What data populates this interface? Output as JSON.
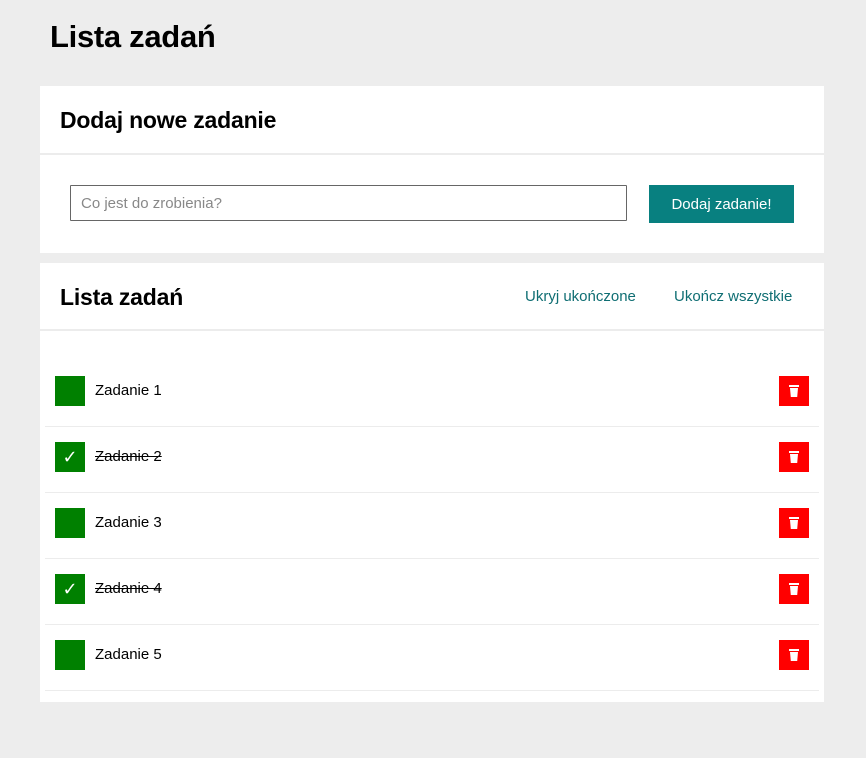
{
  "page": {
    "title": "Lista zadań"
  },
  "add_section": {
    "title": "Dodaj nowe zadanie",
    "input_placeholder": "Co jest do zrobienia?",
    "input_value": "",
    "button_label": "Dodaj zadanie!"
  },
  "list_section": {
    "title": "Lista zadań",
    "hide_completed_label": "Ukryj ukończone",
    "complete_all_label": "Ukończ wszystkie",
    "tasks": [
      {
        "label": "Zadanie 1",
        "done": false
      },
      {
        "label": "Zadanie 2",
        "done": true
      },
      {
        "label": "Zadanie 3",
        "done": false
      },
      {
        "label": "Zadanie 4",
        "done": true
      },
      {
        "label": "Zadanie 5",
        "done": false
      }
    ]
  },
  "icons": {
    "checkmark": "check-icon",
    "delete": "trash-icon"
  },
  "colors": {
    "background": "#ededed",
    "accent": "#088080",
    "link": "#0f6e73",
    "checkbox": "#008000",
    "delete": "#ff0000"
  }
}
